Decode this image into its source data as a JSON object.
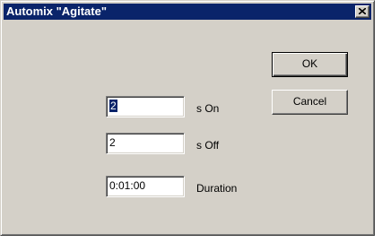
{
  "window": {
    "title": "Automix \"Agitate\"",
    "close_icon": "close-x-icon"
  },
  "fields": {
    "on_value": "2",
    "on_label": "s On",
    "off_value": "2",
    "off_label": "s Off",
    "duration_value": "0:01:00",
    "duration_label": "Duration"
  },
  "buttons": {
    "ok_label": "OK",
    "cancel_label": "Cancel"
  },
  "colors": {
    "titlebar": "#0a246a",
    "face": "#d4d0c8",
    "selection": "#0a246a"
  }
}
